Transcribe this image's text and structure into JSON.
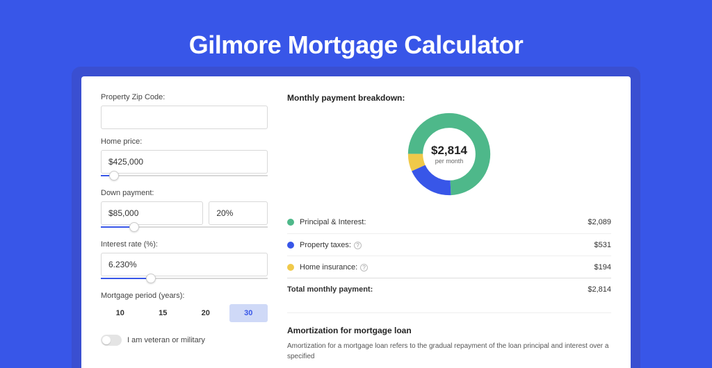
{
  "title": "Gilmore Mortgage Calculator",
  "form": {
    "zip_label": "Property Zip Code:",
    "zip_value": "",
    "home_price_label": "Home price:",
    "home_price_value": "$425,000",
    "home_price_slider_pct": 8,
    "down_payment_label": "Down payment:",
    "down_payment_value": "$85,000",
    "down_payment_pct_value": "20%",
    "down_payment_slider_pct": 20,
    "interest_label": "Interest rate (%):",
    "interest_value": "6.230%",
    "interest_slider_pct": 30,
    "period_label": "Mortgage period (years):",
    "periods": [
      "10",
      "15",
      "20",
      "30"
    ],
    "period_selected": "30",
    "veteran_label": "I am veteran or military"
  },
  "breakdown": {
    "heading": "Monthly payment breakdown:",
    "center_amount": "$2,814",
    "center_sub": "per month",
    "rows": [
      {
        "label": "Principal & Interest:",
        "value": "$2,089",
        "color": "#4eb88a",
        "info": false
      },
      {
        "label": "Property taxes:",
        "value": "$531",
        "color": "#3856e8",
        "info": true
      },
      {
        "label": "Home insurance:",
        "value": "$194",
        "color": "#f0c94a",
        "info": true
      }
    ],
    "total_label": "Total monthly payment:",
    "total_value": "$2,814"
  },
  "chart_data": {
    "type": "pie",
    "title": "Monthly payment breakdown",
    "series": [
      {
        "name": "Principal & Interest",
        "value": 2089,
        "color": "#4eb88a"
      },
      {
        "name": "Property taxes",
        "value": 531,
        "color": "#3856e8"
      },
      {
        "name": "Home insurance",
        "value": 194,
        "color": "#f0c94a"
      }
    ],
    "total": 2814,
    "center_label": "$2,814 per month"
  },
  "amortization": {
    "heading": "Amortization for mortgage loan",
    "text": "Amortization for a mortgage loan refers to the gradual repayment of the loan principal and interest over a specified"
  }
}
